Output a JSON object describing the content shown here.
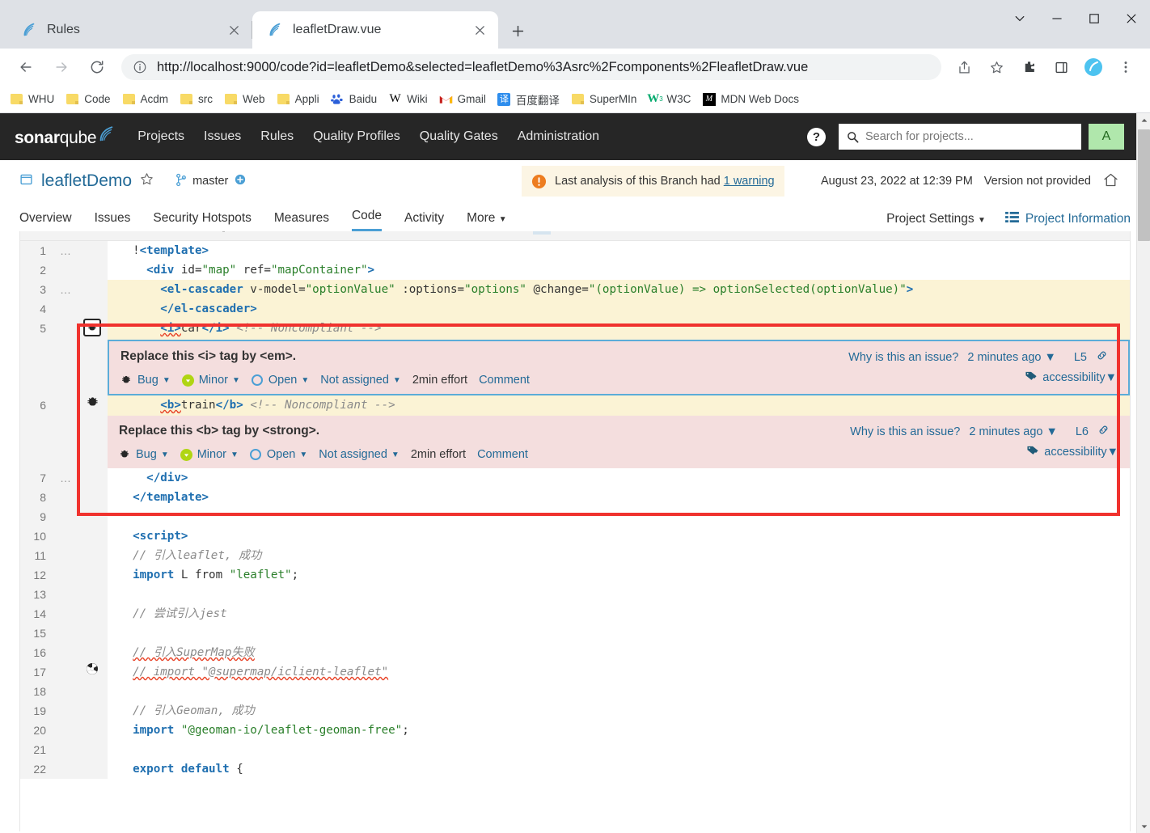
{
  "browser": {
    "tabs": [
      {
        "title": "Rules",
        "favicon": "sonarqube-favicon",
        "active": false
      },
      {
        "title": "leafletDraw.vue",
        "favicon": "sonarqube-favicon",
        "active": true
      }
    ],
    "new_tab_label": "+",
    "url": "http://localhost:9000/code?id=leafletDemo&selected=leafletDemo%3Asrc%2Fcomponents%2FleafletDraw.vue",
    "url_scheme": "http://",
    "url_rest": "localhost:9000/code?id=leafletDemo&selected=leafletDemo%3Asrc%2Fcomponents%2FleafletDraw.vue",
    "bookmarks": [
      {
        "label": "WHU",
        "icon": "folder-icon"
      },
      {
        "label": "Code",
        "icon": "folder-icon"
      },
      {
        "label": "Acdm",
        "icon": "folder-icon"
      },
      {
        "label": "src",
        "icon": "folder-icon"
      },
      {
        "label": "Web",
        "icon": "folder-icon"
      },
      {
        "label": "Appli",
        "icon": "folder-icon"
      },
      {
        "label": "Baidu",
        "icon": "baidu-icon"
      },
      {
        "label": "Wiki",
        "icon": "wikipedia-icon"
      },
      {
        "label": "Gmail",
        "icon": "gmail-icon"
      },
      {
        "label": "百度翻译",
        "icon": "fanyi-icon"
      },
      {
        "label": "SuperMIn",
        "icon": "folder-icon"
      },
      {
        "label": "W3C",
        "icon": "w3schools-icon"
      },
      {
        "label": "MDN Web Docs",
        "icon": "mdn-icon"
      }
    ]
  },
  "sonarqube": {
    "brand_bold": "sonar",
    "brand_light": "qube",
    "nav": [
      "Projects",
      "Issues",
      "Rules",
      "Quality Profiles",
      "Quality Gates",
      "Administration"
    ],
    "search_placeholder": "Search for projects...",
    "avatar_initial": "A",
    "help_label": "?",
    "project": {
      "name": "leafletDemo",
      "branch": "master",
      "warning_text": "Last analysis of this Branch had",
      "warning_link": "1 warning",
      "analysis_date": "August 23, 2022 at 12:39 PM",
      "version": "Version not provided"
    },
    "tabs": [
      {
        "label": "Overview",
        "active": false
      },
      {
        "label": "Issues",
        "active": false
      },
      {
        "label": "Security Hotspots",
        "active": false
      },
      {
        "label": "Measures",
        "active": false
      },
      {
        "label": "Code",
        "active": true
      },
      {
        "label": "Activity",
        "active": false
      },
      {
        "label": "More",
        "active": false,
        "caret": true
      }
    ],
    "project_settings_label": "Project Settings",
    "project_information_label": "Project Information"
  },
  "code": {
    "lines": [
      {
        "n": "1",
        "dots": true,
        "marker": "",
        "highlight": false,
        "tokens": [
          {
            "t": "  ",
            "c": "k-plain"
          },
          {
            "t": "!",
            "c": "k-plain"
          },
          {
            "t": "<template>",
            "c": "k-tag"
          }
        ]
      },
      {
        "n": "2",
        "dots": false,
        "marker": "",
        "highlight": false,
        "tokens": [
          {
            "t": "    ",
            "c": "k-plain"
          },
          {
            "t": "<div",
            "c": "k-tag"
          },
          {
            "t": " id=",
            "c": "k-attr"
          },
          {
            "t": "\"map\"",
            "c": "k-str"
          },
          {
            "t": " ref=",
            "c": "k-attr"
          },
          {
            "t": "\"mapContainer\"",
            "c": "k-str"
          },
          {
            "t": ">",
            "c": "k-tag"
          }
        ]
      },
      {
        "n": "3",
        "dots": true,
        "marker": "",
        "highlight": true,
        "tokens": [
          {
            "t": "      ",
            "c": "k-plain"
          },
          {
            "t": "<el-cascader",
            "c": "k-tag"
          },
          {
            "t": " v-model=",
            "c": "k-attr"
          },
          {
            "t": "\"optionValue\"",
            "c": "k-str"
          },
          {
            "t": " :options=",
            "c": "k-attr"
          },
          {
            "t": "\"options\"",
            "c": "k-str"
          },
          {
            "t": " @change=",
            "c": "k-attr"
          },
          {
            "t": "\"(optionValue) => optionSelected(optionValue)\"",
            "c": "k-str"
          },
          {
            "t": ">",
            "c": "k-tag"
          }
        ]
      },
      {
        "n": "4",
        "dots": false,
        "marker": "",
        "highlight": true,
        "tokens": [
          {
            "t": "      ",
            "c": "k-plain"
          },
          {
            "t": "</el-cascader>",
            "c": "k-tag"
          }
        ]
      },
      {
        "n": "5",
        "dots": false,
        "marker": "bug-boxed",
        "highlight": true,
        "tokens": [
          {
            "t": "      ",
            "c": "k-plain"
          },
          {
            "t": "<i>",
            "c": "k-tag squig"
          },
          {
            "t": "car",
            "c": "k-plain"
          },
          {
            "t": "</i>",
            "c": "k-tag"
          },
          {
            "t": " ",
            "c": "k-plain"
          },
          {
            "t": "<!-- Noncompliant -->",
            "c": "k-cmt"
          }
        ]
      },
      {
        "n": "6",
        "dots": false,
        "marker": "bug",
        "highlight": true,
        "tokens": [
          {
            "t": "      ",
            "c": "k-plain"
          },
          {
            "t": "<b>",
            "c": "k-tag squig"
          },
          {
            "t": "train",
            "c": "k-plain"
          },
          {
            "t": "</b>",
            "c": "k-tag"
          },
          {
            "t": " ",
            "c": "k-plain"
          },
          {
            "t": "<!-- Noncompliant -->",
            "c": "k-cmt"
          }
        ]
      },
      {
        "n": "7",
        "dots": true,
        "marker": "",
        "highlight": false,
        "tokens": [
          {
            "t": "    ",
            "c": "k-plain"
          },
          {
            "t": "</div>",
            "c": "k-tag"
          }
        ]
      },
      {
        "n": "8",
        "dots": false,
        "marker": "",
        "highlight": false,
        "tokens": [
          {
            "t": "  ",
            "c": "k-plain"
          },
          {
            "t": "</template>",
            "c": "k-tag"
          }
        ]
      },
      {
        "n": "9",
        "dots": false,
        "marker": "",
        "highlight": false,
        "tokens": []
      },
      {
        "n": "10",
        "dots": false,
        "marker": "",
        "highlight": false,
        "tokens": [
          {
            "t": "  ",
            "c": "k-plain"
          },
          {
            "t": "<script>",
            "c": "k-tag"
          }
        ]
      },
      {
        "n": "11",
        "dots": false,
        "marker": "",
        "highlight": false,
        "tokens": [
          {
            "t": "  ",
            "c": "k-plain"
          },
          {
            "t": "// 引入leaflet, 成功",
            "c": "k-cmt"
          }
        ]
      },
      {
        "n": "12",
        "dots": false,
        "marker": "",
        "highlight": false,
        "tokens": [
          {
            "t": "  ",
            "c": "k-plain"
          },
          {
            "t": "import",
            "c": "k-kw"
          },
          {
            "t": " L ",
            "c": "k-plain"
          },
          {
            "t": "from",
            "c": "k-plain"
          },
          {
            "t": " ",
            "c": "k-plain"
          },
          {
            "t": "\"leaflet\"",
            "c": "k-green"
          },
          {
            "t": ";",
            "c": "k-plain"
          }
        ]
      },
      {
        "n": "13",
        "dots": false,
        "marker": "",
        "highlight": false,
        "tokens": []
      },
      {
        "n": "14",
        "dots": false,
        "marker": "",
        "highlight": false,
        "tokens": [
          {
            "t": "  ",
            "c": "k-plain"
          },
          {
            "t": "// 尝试引入jest",
            "c": "k-cmt"
          }
        ]
      },
      {
        "n": "15",
        "dots": false,
        "marker": "",
        "highlight": false,
        "tokens": []
      },
      {
        "n": "16",
        "dots": false,
        "marker": "",
        "highlight": false,
        "tokens": [
          {
            "t": "  ",
            "c": "k-plain"
          },
          {
            "t": "// 引入SuperMap失败",
            "c": "k-cmt squig-gray"
          }
        ]
      },
      {
        "n": "17",
        "dots": false,
        "marker": "smell",
        "highlight": false,
        "tokens": [
          {
            "t": "  ",
            "c": "k-plain"
          },
          {
            "t": "// import \"@supermap/iclient-leaflet\"",
            "c": "k-cmt squig-gray"
          }
        ]
      },
      {
        "n": "18",
        "dots": false,
        "marker": "",
        "highlight": false,
        "tokens": []
      },
      {
        "n": "19",
        "dots": false,
        "marker": "",
        "highlight": false,
        "tokens": [
          {
            "t": "  ",
            "c": "k-plain"
          },
          {
            "t": "// 引入Geoman, 成功",
            "c": "k-cmt"
          }
        ]
      },
      {
        "n": "20",
        "dots": false,
        "marker": "",
        "highlight": false,
        "tokens": [
          {
            "t": "  ",
            "c": "k-plain"
          },
          {
            "t": "import",
            "c": "k-kw"
          },
          {
            "t": " ",
            "c": "k-plain"
          },
          {
            "t": "\"@geoman-io/leaflet-geoman-free\"",
            "c": "k-green"
          },
          {
            "t": ";",
            "c": "k-plain"
          }
        ]
      },
      {
        "n": "21",
        "dots": false,
        "marker": "",
        "highlight": false,
        "tokens": []
      },
      {
        "n": "22",
        "dots": false,
        "marker": "",
        "highlight": false,
        "tokens": [
          {
            "t": "  ",
            "c": "k-plain"
          },
          {
            "t": "export default",
            "c": "k-kw"
          },
          {
            "t": " {",
            "c": "k-plain"
          }
        ]
      }
    ]
  },
  "issues": [
    {
      "after_line": "5",
      "title": "Replace this <i> tag by <em>.",
      "type": "Bug",
      "severity": "Minor",
      "status": "Open",
      "assignee": "Not assigned",
      "effort": "2min effort",
      "comment": "Comment",
      "why_link": "Why is this an issue?",
      "age": "2 minutes ago",
      "line_ref": "L5",
      "tag": "accessibility",
      "focused": true
    },
    {
      "after_line": "6",
      "title": "Replace this <b> tag by <strong>.",
      "type": "Bug",
      "severity": "Minor",
      "status": "Open",
      "assignee": "Not assigned",
      "effort": "2min effort",
      "comment": "Comment",
      "why_link": "Why is this an issue?",
      "age": "2 minutes ago",
      "line_ref": "L6",
      "tag": "accessibility",
      "focused": false
    }
  ],
  "annotation": {
    "color": "#f0322e",
    "shape": "rectangle"
  }
}
